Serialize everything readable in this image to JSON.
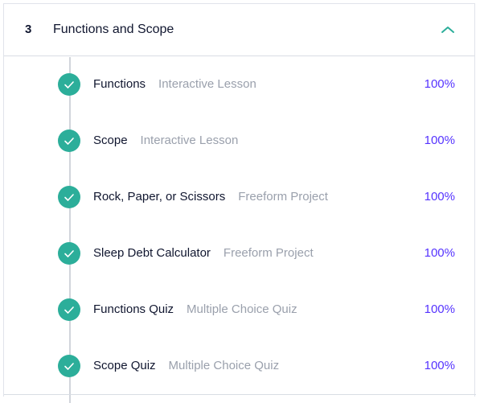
{
  "module": {
    "number": "3",
    "title": "Functions and Scope",
    "toggle_icon": "chevron-up-icon"
  },
  "colors": {
    "check": "#2cae9a",
    "progress": "#5533ff",
    "type": "#9aa0ac",
    "chevron": "#2cae9a"
  },
  "lessons": [
    {
      "title": "Functions",
      "type": "Interactive Lesson",
      "progress": "100%",
      "completed": true
    },
    {
      "title": "Scope",
      "type": "Interactive Lesson",
      "progress": "100%",
      "completed": true
    },
    {
      "title": "Rock, Paper, or Scissors",
      "type": "Freeform Project",
      "progress": "100%",
      "completed": true
    },
    {
      "title": "Sleep Debt Calculator",
      "type": "Freeform Project",
      "progress": "100%",
      "completed": true
    },
    {
      "title": "Functions Quiz",
      "type": "Multiple Choice Quiz",
      "progress": "100%",
      "completed": true
    },
    {
      "title": "Scope Quiz",
      "type": "Multiple Choice Quiz",
      "progress": "100%",
      "completed": true
    }
  ]
}
